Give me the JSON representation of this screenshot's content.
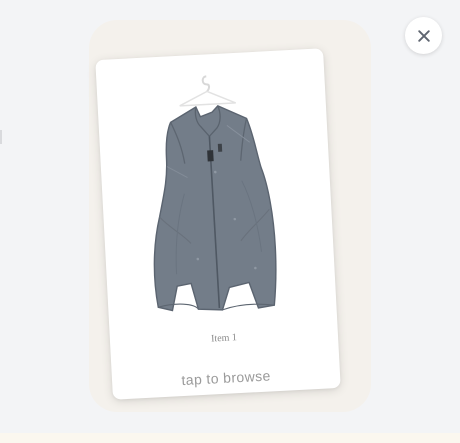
{
  "modal": {
    "close_label": "Close",
    "close_icon": "close-icon"
  },
  "card": {
    "image_subject": "gray fleece vest on hanger",
    "caption": "Item 1",
    "hint": "tap to browse"
  },
  "colors": {
    "backdrop": "#f3f4f6",
    "frame": "#f4f1ec",
    "card": "#ffffff",
    "caption_text": "#8a8a8a",
    "hint_text": "#9a9a9a"
  }
}
